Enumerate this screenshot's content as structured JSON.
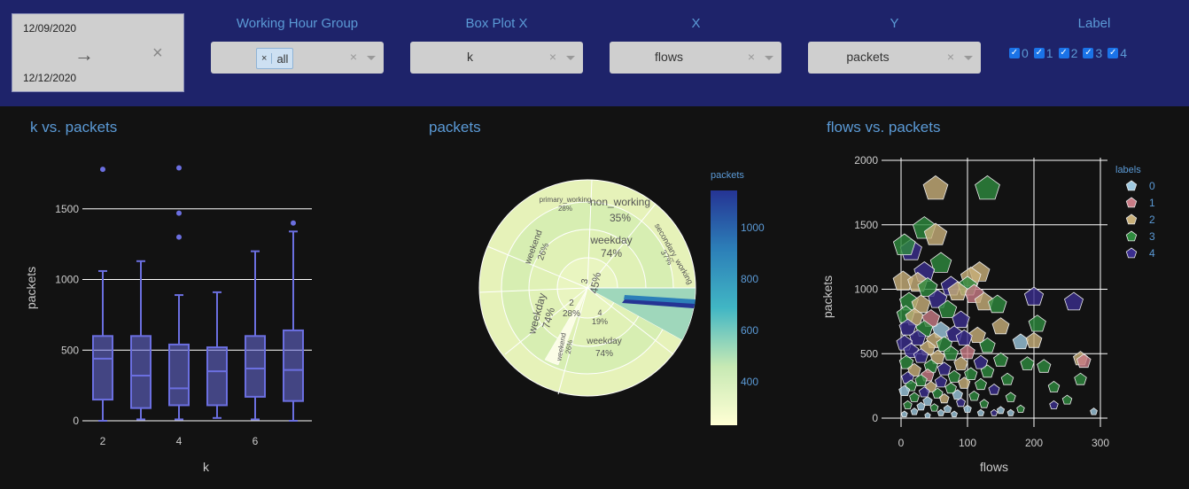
{
  "controls": {
    "date_start": "12/09/2020",
    "date_end": "12/12/2020",
    "working_hour_group": {
      "title": "Working Hour Group",
      "chip": "all"
    },
    "box_plot_x": {
      "title": "Box Plot X",
      "value": "k"
    },
    "x": {
      "title": "X",
      "value": "flows"
    },
    "y": {
      "title": "Y",
      "value": "packets"
    },
    "label": {
      "title": "Label",
      "options": [
        "0",
        "1",
        "2",
        "3",
        "4"
      ]
    },
    "clear_glyph": "×",
    "arrow_glyph": "→"
  },
  "box_chart": {
    "title": "k vs. packets",
    "chart_data": {
      "type": "box",
      "xlabel": "k",
      "ylabel": "packets",
      "x_ticks": [
        "2",
        "4",
        "6"
      ],
      "y_ticks": [
        "0",
        "500",
        "1000",
        "1500"
      ],
      "ylim": [
        0,
        1900
      ],
      "color": "#6b6fe0",
      "boxes": [
        {
          "k": 2,
          "min": 0,
          "q1": 150,
          "median": 440,
          "q3": 600,
          "max": 1060,
          "outliers": [
            1780
          ]
        },
        {
          "k": 3,
          "min": 10,
          "q1": 90,
          "median": 320,
          "q3": 600,
          "max": 1130,
          "outliers": []
        },
        {
          "k": 4,
          "min": 10,
          "q1": 110,
          "median": 230,
          "q3": 540,
          "max": 890,
          "outliers": [
            1300,
            1470,
            1790
          ]
        },
        {
          "k": 5,
          "min": 20,
          "q1": 110,
          "median": 350,
          "q3": 520,
          "max": 910,
          "outliers": []
        },
        {
          "k": 6,
          "min": 10,
          "q1": 170,
          "median": 370,
          "q3": 600,
          "max": 1200,
          "outliers": []
        },
        {
          "k": 7,
          "min": 0,
          "q1": 140,
          "median": 360,
          "q3": 640,
          "max": 1340,
          "outliers": [
            1400
          ]
        }
      ]
    }
  },
  "sunburst_chart": {
    "title": "packets",
    "chart_data": {
      "type": "sunburst",
      "colorbar_title": "packets",
      "colorbar_ticks": [
        "400",
        "600",
        "800",
        "1000"
      ],
      "labels": {
        "root": {
          "name": "3",
          "pct": "45%"
        },
        "k2": {
          "name": "2",
          "pct": "28%"
        },
        "k4": {
          "name": "4",
          "pct": "19%"
        },
        "weekday3": {
          "name": "weekday",
          "pct": "74%"
        },
        "weekend3": {
          "name": "weekend",
          "pct": "26%"
        },
        "weekday2": {
          "name": "weekday",
          "pct": "74%"
        },
        "weekday4": {
          "name": "weekday",
          "pct": "74%"
        },
        "weekend2": {
          "name": "weekend",
          "pct": "26%"
        },
        "non_working": {
          "name": "non_working",
          "pct": "35%"
        },
        "secondary_working": {
          "name": "secondary_working",
          "pct": "37%"
        },
        "primary_working": {
          "name": "primary_working",
          "pct": "28%"
        }
      }
    }
  },
  "scatter_chart": {
    "title": "flows vs. packets",
    "chart_data": {
      "type": "scatter",
      "xlabel": "flows",
      "ylabel": "packets",
      "x_ticks": [
        "0",
        "100",
        "200",
        "300"
      ],
      "y_ticks": [
        "0",
        "500",
        "1000",
        "1500",
        "2000"
      ],
      "xlim": [
        -10,
        305
      ],
      "ylim": [
        -50,
        2000
      ],
      "legend_title": "labels",
      "legend": [
        "0",
        "1",
        "2",
        "3",
        "4"
      ],
      "colors": {
        "0": "#9ec9e0",
        "1": "#c97c86",
        "2": "#c9b07a",
        "3": "#2e8b3e",
        "4": "#3b2e8f"
      },
      "points": [
        {
          "x": 52,
          "y": 1780,
          "label": "2"
        },
        {
          "x": 130,
          "y": 1780,
          "label": "3"
        },
        {
          "x": 35,
          "y": 1470,
          "label": "3"
        },
        {
          "x": 52,
          "y": 1420,
          "label": "2"
        },
        {
          "x": 15,
          "y": 1300,
          "label": "4"
        },
        {
          "x": 5,
          "y": 1340,
          "label": "3"
        },
        {
          "x": 60,
          "y": 1200,
          "label": "3"
        },
        {
          "x": 118,
          "y": 1130,
          "label": "2"
        },
        {
          "x": 105,
          "y": 1090,
          "label": "2"
        },
        {
          "x": 35,
          "y": 1130,
          "label": "4"
        },
        {
          "x": 3,
          "y": 1060,
          "label": "2"
        },
        {
          "x": 25,
          "y": 1050,
          "label": "2"
        },
        {
          "x": 75,
          "y": 1020,
          "label": "4"
        },
        {
          "x": 100,
          "y": 1020,
          "label": "3"
        },
        {
          "x": 110,
          "y": 960,
          "label": "1"
        },
        {
          "x": 85,
          "y": 980,
          "label": "2"
        },
        {
          "x": 40,
          "y": 1010,
          "label": "3"
        },
        {
          "x": 200,
          "y": 940,
          "label": "4"
        },
        {
          "x": 260,
          "y": 900,
          "label": "4"
        },
        {
          "x": 125,
          "y": 900,
          "label": "2"
        },
        {
          "x": 55,
          "y": 920,
          "label": "4"
        },
        {
          "x": 12,
          "y": 900,
          "label": "3"
        },
        {
          "x": 30,
          "y": 880,
          "label": "2"
        },
        {
          "x": 145,
          "y": 880,
          "label": "3"
        },
        {
          "x": 70,
          "y": 840,
          "label": "3"
        },
        {
          "x": 7,
          "y": 800,
          "label": "3"
        },
        {
          "x": 20,
          "y": 780,
          "label": "2"
        },
        {
          "x": 45,
          "y": 770,
          "label": "1"
        },
        {
          "x": 90,
          "y": 760,
          "label": "4"
        },
        {
          "x": 205,
          "y": 730,
          "label": "3"
        },
        {
          "x": 150,
          "y": 710,
          "label": "2"
        },
        {
          "x": 10,
          "y": 700,
          "label": "4"
        },
        {
          "x": 35,
          "y": 690,
          "label": "3"
        },
        {
          "x": 60,
          "y": 680,
          "label": "0"
        },
        {
          "x": 80,
          "y": 650,
          "label": "4"
        },
        {
          "x": 115,
          "y": 640,
          "label": "2"
        },
        {
          "x": 95,
          "y": 620,
          "label": "4"
        },
        {
          "x": 25,
          "y": 620,
          "label": "4"
        },
        {
          "x": 50,
          "y": 600,
          "label": "2"
        },
        {
          "x": 180,
          "y": 590,
          "label": "0"
        },
        {
          "x": 5,
          "y": 580,
          "label": "4"
        },
        {
          "x": 65,
          "y": 570,
          "label": "3"
        },
        {
          "x": 130,
          "y": 560,
          "label": "3"
        },
        {
          "x": 40,
          "y": 540,
          "label": "2"
        },
        {
          "x": 15,
          "y": 520,
          "label": "4"
        },
        {
          "x": 100,
          "y": 510,
          "label": "1"
        },
        {
          "x": 200,
          "y": 600,
          "label": "2"
        },
        {
          "x": 270,
          "y": 460,
          "label": "2"
        },
        {
          "x": 275,
          "y": 440,
          "label": "1"
        },
        {
          "x": 75,
          "y": 500,
          "label": "3"
        },
        {
          "x": 30,
          "y": 480,
          "label": "4"
        },
        {
          "x": 55,
          "y": 470,
          "label": "2"
        },
        {
          "x": 150,
          "y": 450,
          "label": "3"
        },
        {
          "x": 120,
          "y": 430,
          "label": "4"
        },
        {
          "x": 8,
          "y": 430,
          "label": "3"
        },
        {
          "x": 90,
          "y": 420,
          "label": "2"
        },
        {
          "x": 190,
          "y": 420,
          "label": "3"
        },
        {
          "x": 45,
          "y": 400,
          "label": "3"
        },
        {
          "x": 65,
          "y": 380,
          "label": "4"
        },
        {
          "x": 20,
          "y": 370,
          "label": "2"
        },
        {
          "x": 130,
          "y": 360,
          "label": "3"
        },
        {
          "x": 215,
          "y": 400,
          "label": "3"
        },
        {
          "x": 105,
          "y": 340,
          "label": "3"
        },
        {
          "x": 40,
          "y": 330,
          "label": "1"
        },
        {
          "x": 80,
          "y": 320,
          "label": "3"
        },
        {
          "x": 10,
          "y": 310,
          "label": "4"
        },
        {
          "x": 160,
          "y": 300,
          "label": "3"
        },
        {
          "x": 270,
          "y": 300,
          "label": "3"
        },
        {
          "x": 30,
          "y": 290,
          "label": "3"
        },
        {
          "x": 60,
          "y": 280,
          "label": "4"
        },
        {
          "x": 95,
          "y": 270,
          "label": "2"
        },
        {
          "x": 120,
          "y": 260,
          "label": "3"
        },
        {
          "x": 15,
          "y": 250,
          "label": "3"
        },
        {
          "x": 45,
          "y": 240,
          "label": "2"
        },
        {
          "x": 75,
          "y": 230,
          "label": "3"
        },
        {
          "x": 230,
          "y": 240,
          "label": "3"
        },
        {
          "x": 140,
          "y": 220,
          "label": "4"
        },
        {
          "x": 5,
          "y": 210,
          "label": "0"
        },
        {
          "x": 35,
          "y": 200,
          "label": "4"
        },
        {
          "x": 55,
          "y": 190,
          "label": "3"
        },
        {
          "x": 85,
          "y": 180,
          "label": "0"
        },
        {
          "x": 110,
          "y": 170,
          "label": "3"
        },
        {
          "x": 165,
          "y": 160,
          "label": "3"
        },
        {
          "x": 20,
          "y": 160,
          "label": "3"
        },
        {
          "x": 65,
          "y": 150,
          "label": "2"
        },
        {
          "x": 250,
          "y": 140,
          "label": "3"
        },
        {
          "x": 40,
          "y": 130,
          "label": "0"
        },
        {
          "x": 90,
          "y": 120,
          "label": "4"
        },
        {
          "x": 125,
          "y": 110,
          "label": "3"
        },
        {
          "x": 10,
          "y": 100,
          "label": "3"
        },
        {
          "x": 30,
          "y": 90,
          "label": "0"
        },
        {
          "x": 50,
          "y": 80,
          "label": "3"
        },
        {
          "x": 70,
          "y": 70,
          "label": "0"
        },
        {
          "x": 100,
          "y": 70,
          "label": "0"
        },
        {
          "x": 150,
          "y": 60,
          "label": "0"
        },
        {
          "x": 180,
          "y": 70,
          "label": "3"
        },
        {
          "x": 230,
          "y": 100,
          "label": "4"
        },
        {
          "x": 20,
          "y": 50,
          "label": "0"
        },
        {
          "x": 60,
          "y": 40,
          "label": "0"
        },
        {
          "x": 80,
          "y": 30,
          "label": "0"
        },
        {
          "x": 120,
          "y": 40,
          "label": "0"
        },
        {
          "x": 5,
          "y": 30,
          "label": "0"
        },
        {
          "x": 40,
          "y": 20,
          "label": "0"
        },
        {
          "x": 140,
          "y": 40,
          "label": "4"
        },
        {
          "x": 290,
          "y": 50,
          "label": "0"
        },
        {
          "x": 165,
          "y": 40,
          "label": "0"
        }
      ]
    }
  }
}
